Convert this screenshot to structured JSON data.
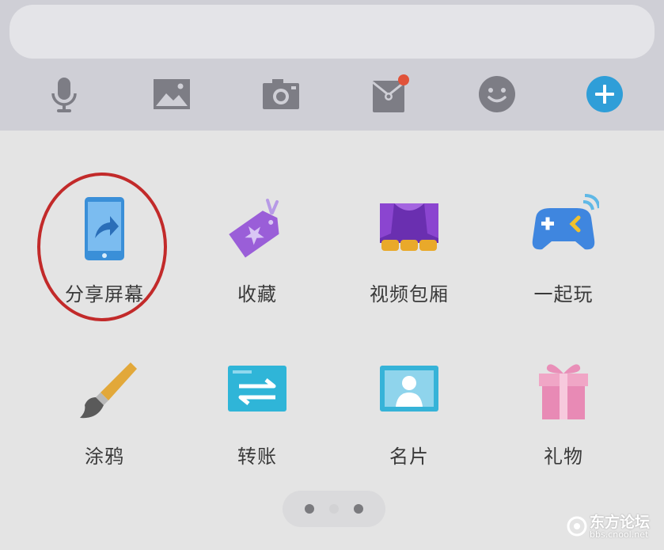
{
  "message_input": {
    "value": ""
  },
  "toolbar": {
    "icons": [
      "microphone-icon",
      "image-icon",
      "camera-icon",
      "red-packet-icon",
      "emoji-icon",
      "plus-icon"
    ],
    "red_packet_badge_color": "#e1533a",
    "plus_color": "#2f9ed8"
  },
  "apps": [
    {
      "label": "分享屏幕",
      "icon": "share-screen-icon"
    },
    {
      "label": "收藏",
      "icon": "favorites-icon"
    },
    {
      "label": "视频包厢",
      "icon": "video-theater-icon"
    },
    {
      "label": "一起玩",
      "icon": "gamepad-icon"
    },
    {
      "label": "涂鸦",
      "icon": "paintbrush-icon"
    },
    {
      "label": "转账",
      "icon": "transfer-icon"
    },
    {
      "label": "名片",
      "icon": "contact-card-icon"
    },
    {
      "label": "礼物",
      "icon": "gift-icon"
    }
  ],
  "highlight": {
    "target": "分享屏幕",
    "color": "#c22a2a"
  },
  "pager": {
    "pages": 3,
    "current": 2
  },
  "watermark": {
    "name": "东方论坛",
    "url": "bbs.cnool.net"
  }
}
